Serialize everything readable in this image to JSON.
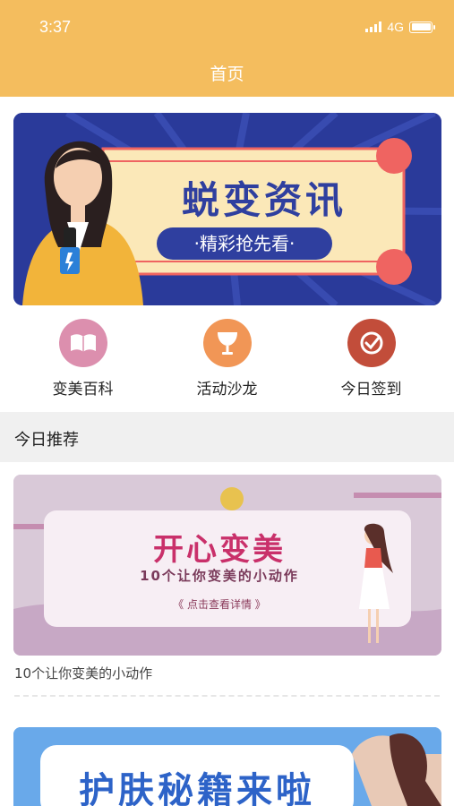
{
  "status_bar": {
    "time": "3:37",
    "network": "4G"
  },
  "header": {
    "title": "首页"
  },
  "banner": {
    "headline": "蜕变资讯",
    "subline": "·精彩抢先看·"
  },
  "shortcuts": [
    {
      "label": "变美百科",
      "icon": "book-icon",
      "color": "#dc8fae"
    },
    {
      "label": "活动沙龙",
      "icon": "cup-icon",
      "color": "#f19656"
    },
    {
      "label": "今日签到",
      "icon": "check-icon",
      "color": "#c24d3a"
    }
  ],
  "section": {
    "title": "今日推荐"
  },
  "cards": [
    {
      "headline": "开心变美",
      "subline": "10个让你变美的小动作",
      "button": "《 点击查看详情 》",
      "caption": "10个让你变美的小动作"
    },
    {
      "headline": "护肤秘籍来啦"
    }
  ],
  "colors": {
    "header": "#f4bd5e",
    "banner_bg": "#2a3a9a",
    "accent_red": "#ef6461"
  }
}
